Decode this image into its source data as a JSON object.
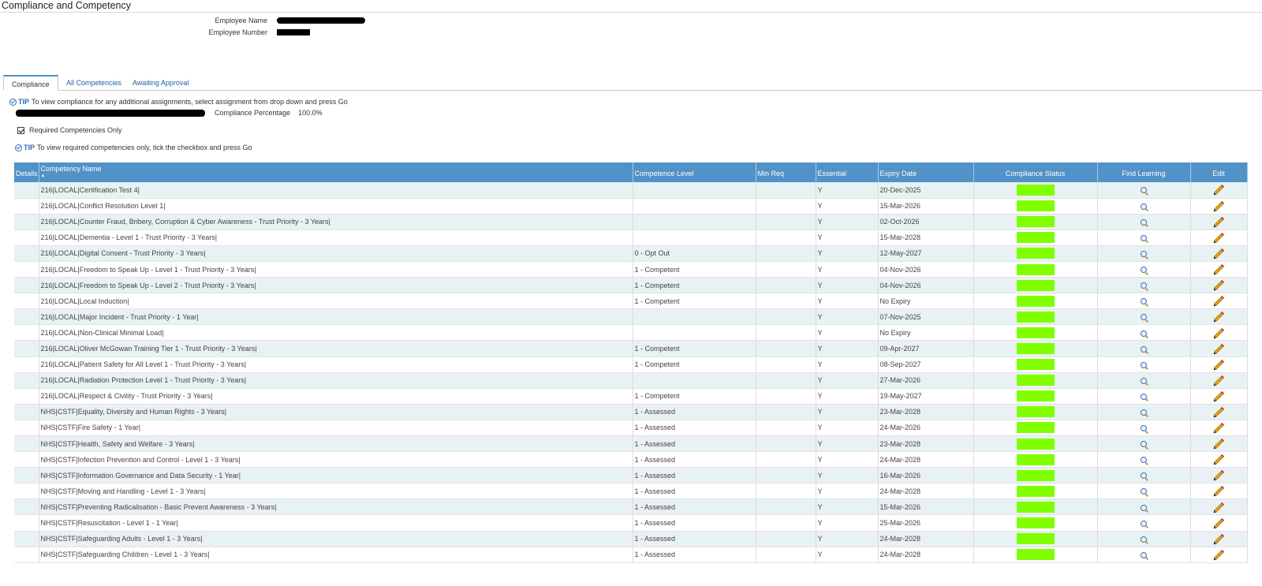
{
  "page": {
    "title": "Compliance and Competency"
  },
  "employee": {
    "name_label": "Employee Name",
    "number_label": "Employee Number"
  },
  "tabs": [
    {
      "label": "Compliance",
      "active": true
    },
    {
      "label": "All Competencies",
      "active": false
    },
    {
      "label": "Awaiting Approval",
      "active": false
    }
  ],
  "tips": {
    "word": "TIP",
    "assignment": "To view compliance for any additional assignments, select assignment from drop down and press Go",
    "required": "To view required competencies only, tick the checkbox and press Go"
  },
  "compliance": {
    "label": "Compliance Percentage",
    "value": "100.0%"
  },
  "filter": {
    "required_label": "Required Competencies Only",
    "checked": true
  },
  "table": {
    "headers": {
      "details": "Details",
      "name": "Competency Name",
      "level": "Competence Level",
      "minreq": "Min Req",
      "essential": "Essential",
      "expiry": "Expiry Date",
      "status": "Compliance Status",
      "learning": "Find Learning",
      "edit": "Edit"
    },
    "sort_indicator": "▲",
    "status_color": "#7fff00",
    "rows": [
      {
        "name": "216|LOCAL|Certification Test 4|",
        "level": "",
        "minreq": "",
        "essential": "Y",
        "expiry": "20-Dec-2025"
      },
      {
        "name": "216|LOCAL|Conflict Resolution Level 1|",
        "level": "",
        "minreq": "",
        "essential": "Y",
        "expiry": "15-Mar-2026"
      },
      {
        "name": "216|LOCAL|Counter Fraud, Bribery, Corruption & Cyber Awareness - Trust Priority - 3 Years|",
        "level": "",
        "minreq": "",
        "essential": "Y",
        "expiry": "02-Oct-2026"
      },
      {
        "name": "216|LOCAL|Dementia - Level 1 - Trust Priority - 3 Years|",
        "level": "",
        "minreq": "",
        "essential": "Y",
        "expiry": "15-Mar-2028"
      },
      {
        "name": "216|LOCAL|Digital Consent - Trust Priority - 3 Years|",
        "level": "0 - Opt Out",
        "minreq": "",
        "essential": "Y",
        "expiry": "12-May-2027"
      },
      {
        "name": "216|LOCAL|Freedom to Speak Up - Level 1 - Trust Priority - 3 Years|",
        "level": "1 - Competent",
        "minreq": "",
        "essential": "Y",
        "expiry": "04-Nov-2026"
      },
      {
        "name": "216|LOCAL|Freedom to Speak Up - Level 2 - Trust Priority - 3 Years|",
        "level": "1 - Competent",
        "minreq": "",
        "essential": "Y",
        "expiry": "04-Nov-2026"
      },
      {
        "name": "216|LOCAL|Local Induction|",
        "level": "1 - Competent",
        "minreq": "",
        "essential": "Y",
        "expiry": "No Expiry"
      },
      {
        "name": "216|LOCAL|Major Incident - Trust Priority - 1 Year|",
        "level": "",
        "minreq": "",
        "essential": "Y",
        "expiry": "07-Nov-2025"
      },
      {
        "name": "216|LOCAL|Non-Clinical Minimal Load|",
        "level": "",
        "minreq": "",
        "essential": "Y",
        "expiry": "No Expiry"
      },
      {
        "name": "216|LOCAL|Oliver McGowan Training Tier 1 - Trust Priority - 3 Years|",
        "level": "1 - Competent",
        "minreq": "",
        "essential": "Y",
        "expiry": "09-Apr-2027"
      },
      {
        "name": "216|LOCAL|Patient Safety for All Level 1 - Trust Priority - 3 Years|",
        "level": "1 - Competent",
        "minreq": "",
        "essential": "Y",
        "expiry": "08-Sep-2027"
      },
      {
        "name": "216|LOCAL|Radiation Protection Level 1 - Trust Priority - 3 Years|",
        "level": "",
        "minreq": "",
        "essential": "Y",
        "expiry": "27-Mar-2026"
      },
      {
        "name": "216|LOCAL|Respect & Civility - Trust Priority - 3 Years|",
        "level": "1 - Competent",
        "minreq": "",
        "essential": "Y",
        "expiry": "19-May-2027"
      },
      {
        "name": "NHS|CSTF|Equality, Diversity and Human Rights - 3 Years|",
        "level": "1 - Assessed",
        "minreq": "",
        "essential": "Y",
        "expiry": "23-Mar-2028"
      },
      {
        "name": "NHS|CSTF|Fire Safety - 1 Year|",
        "level": "1 - Assessed",
        "minreq": "",
        "essential": "Y",
        "expiry": "24-Mar-2026"
      },
      {
        "name": "NHS|CSTF|Health, Safety and Welfare - 3 Years|",
        "level": "1 - Assessed",
        "minreq": "",
        "essential": "Y",
        "expiry": "23-Mar-2028"
      },
      {
        "name": "NHS|CSTF|Infection Prevention and Control - Level 1 - 3 Years|",
        "level": "1 - Assessed",
        "minreq": "",
        "essential": "Y",
        "expiry": "24-Mar-2028"
      },
      {
        "name": "NHS|CSTF|Information Governance and Data Security - 1 Year|",
        "level": "1 - Assessed",
        "minreq": "",
        "essential": "Y",
        "expiry": "16-Mar-2026"
      },
      {
        "name": "NHS|CSTF|Moving and Handling - Level 1 - 3 Years|",
        "level": "1 - Assessed",
        "minreq": "",
        "essential": "Y",
        "expiry": "24-Mar-2028"
      },
      {
        "name": "NHS|CSTF|Preventing Radicalisation - Basic Prevent Awareness - 3 Years|",
        "level": "1 - Assessed",
        "minreq": "",
        "essential": "Y",
        "expiry": "15-Mar-2026"
      },
      {
        "name": "NHS|CSTF|Resuscitation - Level 1 - 1 Year|",
        "level": "1 - Assessed",
        "minreq": "",
        "essential": "Y",
        "expiry": "25-Mar-2026"
      },
      {
        "name": "NHS|CSTF|Safeguarding Adults - Level 1 - 3 Years|",
        "level": "1 - Assessed",
        "minreq": "",
        "essential": "Y",
        "expiry": "24-Mar-2028"
      },
      {
        "name": "NHS|CSTF|Safeguarding Children - Level 1 - 3 Years|",
        "level": "1 - Assessed",
        "minreq": "",
        "essential": "Y",
        "expiry": "24-Mar-2028"
      }
    ]
  }
}
